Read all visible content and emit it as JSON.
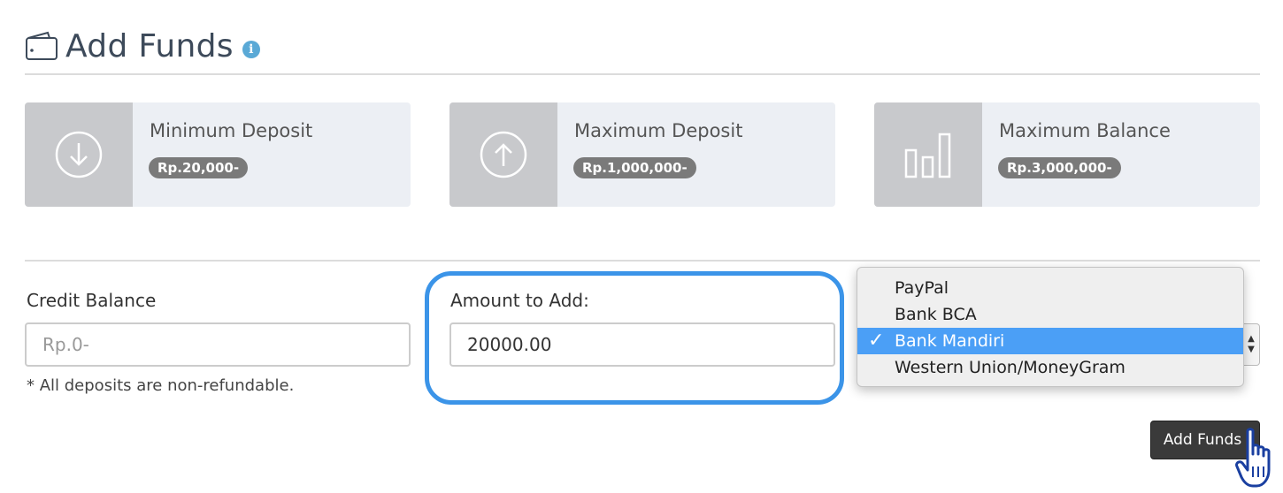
{
  "header": {
    "title": "Add Funds",
    "icon": "wallet-icon",
    "info_icon": "info-icon",
    "info_glyph": "i"
  },
  "stats": [
    {
      "label": "Minimum Deposit",
      "value": "Rp.20,000-",
      "icon": "arrow-down-circle-icon"
    },
    {
      "label": "Maximum Deposit",
      "value": "Rp.1,000,000-",
      "icon": "arrow-up-circle-icon"
    },
    {
      "label": "Maximum Balance",
      "value": "Rp.3,000,000-",
      "icon": "bar-chart-icon"
    }
  ],
  "form": {
    "credit_label": "Credit Balance",
    "credit_value": "Rp.0-",
    "note": "* All deposits are non-refundable.",
    "amount_label": "Amount to Add:",
    "amount_value": "20000.00",
    "payment_options": [
      "PayPal",
      "Bank BCA",
      "Bank Mandiri",
      "Western Union/MoneyGram"
    ],
    "payment_selected": "Bank Mandiri",
    "check_glyph": "✓",
    "submit_label": "Add Funds"
  },
  "colors": {
    "accent": "#3b94e8",
    "selected_option": "#4b9ff6",
    "badge": "#7a7a7a",
    "card_bg": "#eceff4",
    "icon_box": "#c8c9cc",
    "button": "#3a3a3a"
  }
}
